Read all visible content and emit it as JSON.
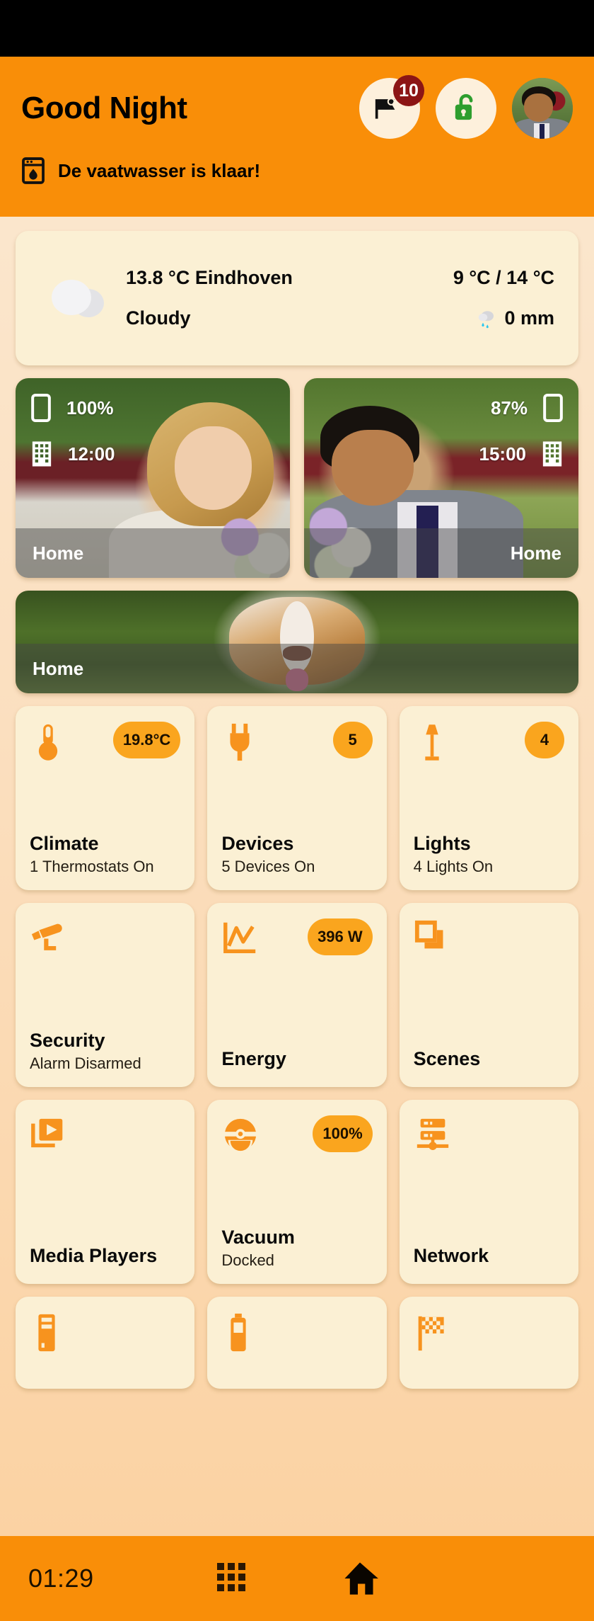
{
  "header": {
    "greeting": "Good Night",
    "messages_badge": "10",
    "message_icon": "flag-message-icon",
    "lock_icon": "unlocked-padlock-icon",
    "avatar_icon": "user-avatar",
    "notification": {
      "icon": "dishwasher-icon",
      "text": "De vaatwasser is klaar!"
    }
  },
  "weather": {
    "icon": "cloud-icon",
    "temp_location": "13.8 °C Eindhoven",
    "range": "9 °C / 14 °C",
    "condition": "Cloudy",
    "precip_icon": "rain-drop-icon",
    "precipitation": "0 mm"
  },
  "people": [
    {
      "battery": "100%",
      "time": "12:00",
      "location": "Home",
      "battery_icon": "phone-icon",
      "work_icon": "office-building-icon",
      "align": "left"
    },
    {
      "battery": "87%",
      "time": "15:00",
      "location": "Home",
      "battery_icon": "phone-icon",
      "work_icon": "office-building-icon",
      "align": "right"
    }
  ],
  "pet": {
    "location": "Home"
  },
  "tiles": [
    {
      "icon": "thermometer-icon",
      "badge": "19.8°C",
      "title": "Climate",
      "subtitle": "1 Thermostats On"
    },
    {
      "icon": "power-plug-icon",
      "badge": "5",
      "title": "Devices",
      "subtitle": "5 Devices On"
    },
    {
      "icon": "floor-lamp-icon",
      "badge": "4",
      "title": "Lights",
      "subtitle": "4 Lights On"
    },
    {
      "icon": "security-camera-icon",
      "badge": "",
      "title": "Security",
      "subtitle": "Alarm Disarmed"
    },
    {
      "icon": "chart-line-icon",
      "badge": "396 W",
      "title": "Energy",
      "subtitle": ""
    },
    {
      "icon": "layers-icon",
      "badge": "",
      "title": "Scenes",
      "subtitle": ""
    },
    {
      "icon": "media-play-icon",
      "badge": "",
      "title": "Media Players",
      "subtitle": ""
    },
    {
      "icon": "robot-vacuum-icon",
      "badge": "100%",
      "title": "Vacuum",
      "subtitle": "Docked"
    },
    {
      "icon": "network-server-icon",
      "badge": "",
      "title": "Network",
      "subtitle": ""
    }
  ],
  "tiles_partial": [
    {
      "icon": "server-tower-icon"
    },
    {
      "icon": "battery-icon"
    },
    {
      "icon": "checkered-flag-icon"
    }
  ],
  "bottom_nav": {
    "clock": "01:29",
    "grid_icon": "apps-grid-icon",
    "home_icon": "home-icon"
  },
  "colors": {
    "accent": "#f98e08",
    "badge_orange": "#faa51e",
    "card_bg": "#fbf0d4",
    "notification_red": "#8c1515",
    "lock_green": "#2e9e2e",
    "icon_orange": "#f7931e"
  }
}
